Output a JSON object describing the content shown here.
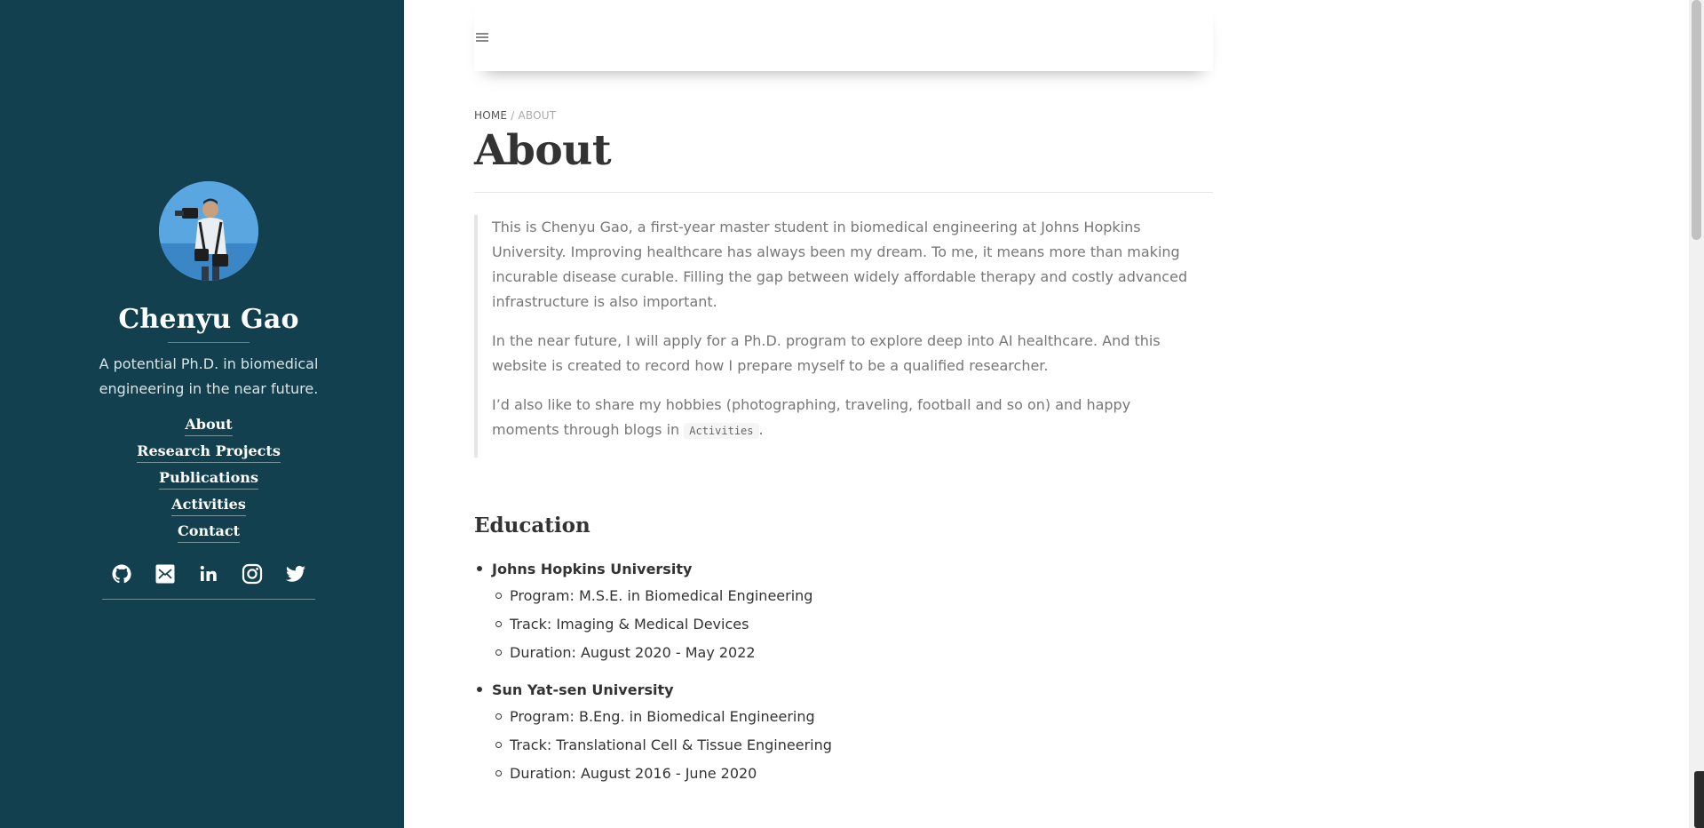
{
  "sidebar": {
    "name": "Chenyu Gao",
    "tagline": "A potential Ph.D. in biomedical engineering in the near future.",
    "nav": [
      {
        "label": "About"
      },
      {
        "label": "Research Projects"
      },
      {
        "label": "Publications"
      },
      {
        "label": "Activities"
      },
      {
        "label": "Contact"
      }
    ],
    "social": [
      {
        "icon": "github-icon"
      },
      {
        "icon": "email-icon"
      },
      {
        "icon": "linkedin-icon"
      },
      {
        "icon": "instagram-icon"
      },
      {
        "icon": "twitter-icon"
      }
    ],
    "background": "#12404f"
  },
  "header": {
    "menu_icon": "hamburger-menu-icon"
  },
  "breadcrumb": {
    "home": "HOME",
    "separator": "/",
    "current": "ABOUT"
  },
  "page": {
    "title": "About",
    "intro": [
      "This is Chenyu Gao, a first-year master student in biomedical engineering at Johns Hopkins University. Improving healthcare has always been my dream. To me, it means more than making incurable disease curable. Filling the gap between widely affordable therapy and costly advanced infrastructure is also important.",
      "In the near future, I will apply for a Ph.D. program to explore deep into AI healthcare. And this website is created to record how I prepare myself to be a qualified researcher.",
      "I’d also like to share my hobbies (photographing, traveling, football and so on) and happy moments through blogs in"
    ],
    "intro_code": "Activities",
    "intro_end": ".",
    "education_heading": "Education",
    "education": [
      {
        "school": "Johns Hopkins University",
        "details": [
          "Program: M.S.E. in Biomedical Engineering",
          "Track: Imaging & Medical Devices",
          "Duration: August 2020 - May 2022"
        ]
      },
      {
        "school": "Sun Yat-sen University",
        "details": [
          "Program: B.Eng. in Biomedical Engineering",
          "Track: Translational Cell & Tissue Engineering",
          "Duration: August 2016 - June 2020"
        ]
      }
    ]
  }
}
